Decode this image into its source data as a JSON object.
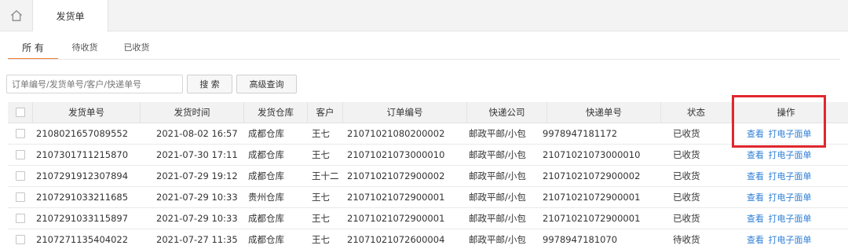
{
  "home": {
    "icon": "home-icon"
  },
  "doc_tab": {
    "label": "发货单"
  },
  "sub_tabs": [
    "所 有",
    "待收货",
    "已收货"
  ],
  "search": {
    "placeholder": "订单编号/发货单号/客户/快递单号",
    "value": ""
  },
  "buttons": {
    "search": "搜 索",
    "advanced": "高级查询"
  },
  "columns": [
    "发货单号",
    "发货时间",
    "发货仓库",
    "客户",
    "订单编号",
    "快递公司",
    "快递单号",
    "状态",
    "操作"
  ],
  "rows": [
    {
      "shipment_no": "2108021657089552",
      "time": "2021-08-02 16:57",
      "warehouse": "成都仓库",
      "customer": "王七",
      "order_no": "21071021080200002",
      "express": "邮政平邮/小包",
      "tracking_no": "9978947181172",
      "status": "已收货"
    },
    {
      "shipment_no": "2107301711215870",
      "time": "2021-07-30 17:11",
      "warehouse": "成都仓库",
      "customer": "王七",
      "order_no": "21071021073000010",
      "express": "邮政平邮/小包",
      "tracking_no": "21071021073000010",
      "status": "已收货"
    },
    {
      "shipment_no": "2107291912307894",
      "time": "2021-07-29 19:12",
      "warehouse": "成都仓库",
      "customer": "王十二",
      "order_no": "21071021072900002",
      "express": "邮政平邮/小包",
      "tracking_no": "21071021072900002",
      "status": "已收货"
    },
    {
      "shipment_no": "2107291033211685",
      "time": "2021-07-29 10:33",
      "warehouse": "贵州仓库",
      "customer": "王七",
      "order_no": "21071021072900001",
      "express": "邮政平邮/小包",
      "tracking_no": "21071021072900001",
      "status": "已收货"
    },
    {
      "shipment_no": "2107291033115897",
      "time": "2021-07-29 10:33",
      "warehouse": "成都仓库",
      "customer": "王七",
      "order_no": "21071021072900001",
      "express": "邮政平邮/小包",
      "tracking_no": "21071021072900001",
      "status": "已收货"
    },
    {
      "shipment_no": "2107271135404022",
      "time": "2021-07-27 11:35",
      "warehouse": "成都仓库",
      "customer": "王七",
      "order_no": "21071021072600004",
      "express": "邮政平邮/小包",
      "tracking_no": "9978947181070",
      "status": "待收货"
    }
  ],
  "actions": {
    "view": "查看",
    "print": "打电子面单"
  },
  "colors": {
    "accent": "#f07c2e",
    "link": "#2f7fd6",
    "highlight": "#e0272d"
  }
}
